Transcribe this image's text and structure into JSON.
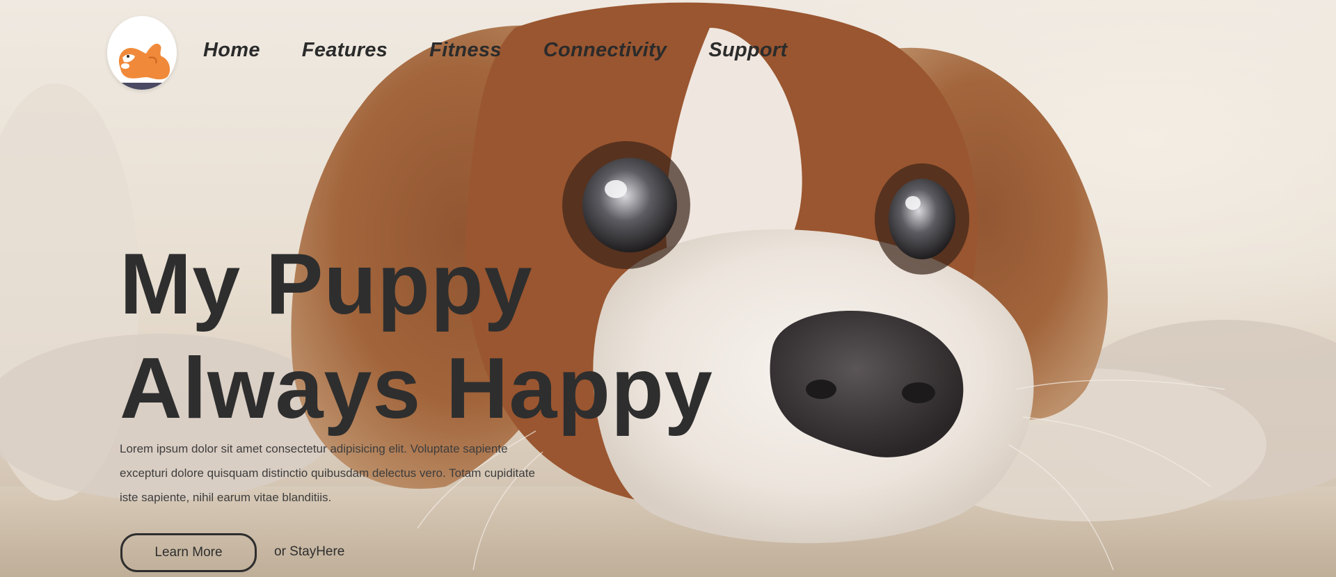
{
  "hero": {
    "image": "puppy-photo",
    "headline_line1": "My Puppy",
    "headline_line2": "Always Happy",
    "description": "Lorem ipsum dolor sit amet consectetur adipisicing elit. Voluptate sapiente excepturi dolore quisquam distinctio quibusdam delectus vero. Totam cupiditate iste sapiente, nihil earum vitae blanditiis.",
    "primary_cta": "Learn More",
    "secondary_cta": "or StayHere"
  },
  "nav": {
    "logo_icon": "dog-logo-icon",
    "items": [
      {
        "label": "Home"
      },
      {
        "label": "Features"
      },
      {
        "label": "Fitness"
      },
      {
        "label": "Connectivity"
      },
      {
        "label": "Support"
      }
    ]
  },
  "colors": {
    "text": "#2e2e2e",
    "logo_dog": "#f08a3a",
    "background": "#ede6dc"
  }
}
